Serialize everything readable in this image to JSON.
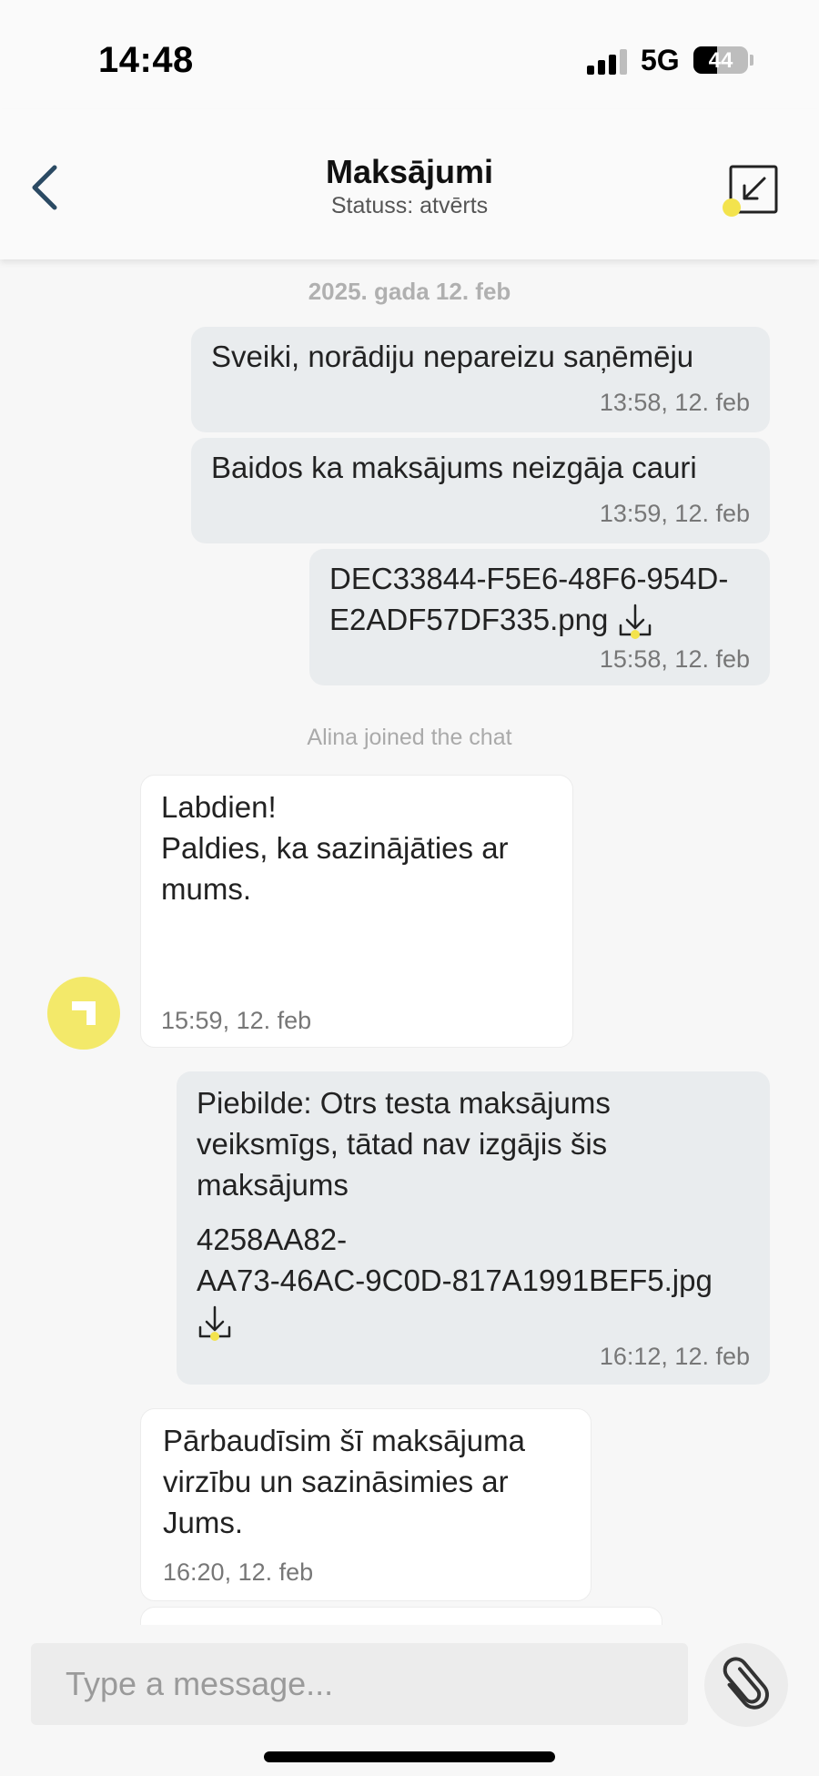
{
  "status_bar": {
    "time": "14:48",
    "network": "5G",
    "battery": "44",
    "battery_level": 0.44
  },
  "header": {
    "title": "Maksājumi",
    "status": "Statuss: atvērts",
    "icons": {
      "back": "chevron-left-icon",
      "minimize": "minimize-arrow-icon"
    }
  },
  "chat": {
    "date_separator": "2025. gada 12. feb",
    "system_joined": "Alina joined the chat",
    "messages": [
      {
        "text": "Sveiki, norādiju nepareizu saņēmēju",
        "time": "13:58, 12. feb"
      },
      {
        "text": "Baidos ka maksājums neizgāja cauri",
        "time": "13:59, 12. feb"
      },
      {
        "attachment_line1": "DEC33844-F5E6-48F6-954D-",
        "attachment_line2": "E2ADF57DF335.png",
        "time": "15:58, 12. feb"
      },
      {
        "line1": "Labdien!",
        "line2": "Paldies, ka sazinājāties ar",
        "line3": "mums.",
        "time": "15:59, 12. feb"
      },
      {
        "line1": "Piebilde: Otrs testa maksājums",
        "line2": "veiksmīgs, tātad nav izgājis šis",
        "line3": "maksājums",
        "attachment_line1": "4258AA82-",
        "attachment_line2": "AA73-46AC-9C0D-817A1991BEF5.jpg",
        "time": "16:12, 12. feb"
      },
      {
        "line1": "Pārbaudīsim šī maksājuma",
        "line2": "virzību un sazināsimies ar",
        "line3": "Jums.",
        "time": "16:20, 12. feb"
      }
    ]
  },
  "composer": {
    "placeholder": "Type a message...",
    "attach_icon": "paperclip-icon"
  },
  "colors": {
    "accent": "#f3e34d",
    "header_icon": "#2b4a63",
    "outgoing_bubble": "#e9ecee",
    "incoming_bubble": "#ffffff"
  }
}
